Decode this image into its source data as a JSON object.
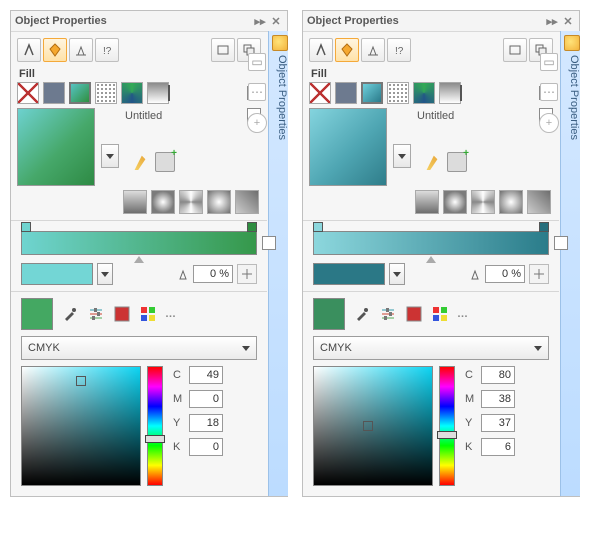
{
  "panels": [
    {
      "title": "Object Properties",
      "side_tab": "Object Properties",
      "fill_label": "Fill",
      "gradient_name": "Untitled",
      "opacity_value": "0 %",
      "color_model": "CMYK",
      "cmyk": {
        "C": "49",
        "M": "0",
        "Y": "18",
        "K": "0"
      },
      "variant": "green",
      "sv_marker": {
        "left": "50%",
        "top": "12%"
      },
      "hue_thumb_top": "58%"
    },
    {
      "title": "Object Properties",
      "side_tab": "Object Properties",
      "fill_label": "Fill",
      "gradient_name": "Untitled",
      "opacity_value": "0 %",
      "color_model": "CMYK",
      "cmyk": {
        "C": "80",
        "M": "38",
        "Y": "37",
        "K": "6"
      },
      "variant": "teal",
      "sv_marker": {
        "left": "46%",
        "top": "50%"
      },
      "hue_thumb_top": "54%"
    }
  ],
  "labels": {
    "C": "C",
    "M": "M",
    "Y": "Y",
    "K": "K"
  }
}
